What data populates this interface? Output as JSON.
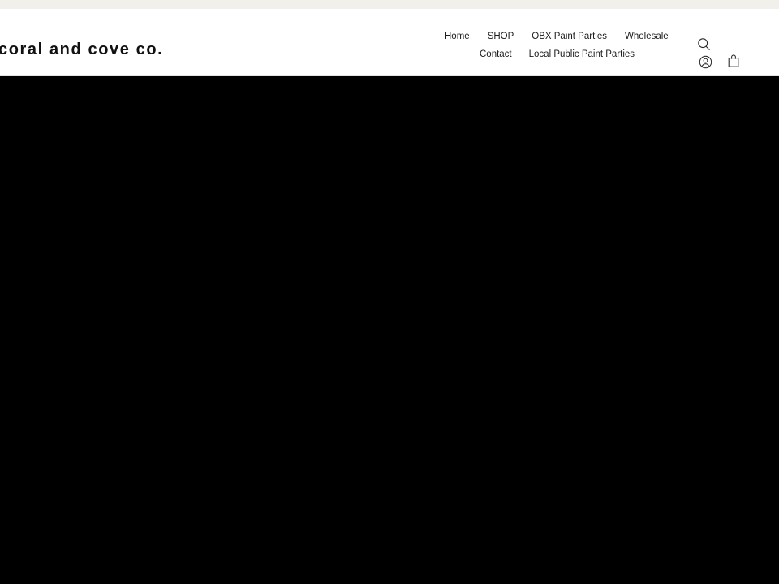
{
  "announcement": {
    "text": ""
  },
  "header": {
    "brand": "coral and cove co.",
    "nav_rows": [
      [
        {
          "label": "Home",
          "name": "nav-link-home"
        },
        {
          "label": "SHOP",
          "name": "nav-link-shop"
        },
        {
          "label": "OBX Paint Parties",
          "name": "nav-link-obx-paint-parties"
        },
        {
          "label": "Wholesale",
          "name": "nav-link-wholesale"
        }
      ],
      [
        {
          "label": "Contact",
          "name": "nav-link-contact"
        },
        {
          "label": "Local Public Paint Parties",
          "name": "nav-link-local-public-paint-parties"
        }
      ]
    ],
    "icons": [
      {
        "name": "search-icon",
        "label": "search"
      },
      {
        "name": "account-icon",
        "label": "account"
      },
      {
        "name": "cart-icon",
        "label": "cart"
      }
    ]
  },
  "hero": {
    "content": ""
  },
  "colors": {
    "announcement_bg": "#f2f0ea",
    "header_bg": "#ffffff",
    "hero_bg": "#000000",
    "text": "#1c1c1c",
    "border": "#e3e3e3"
  }
}
